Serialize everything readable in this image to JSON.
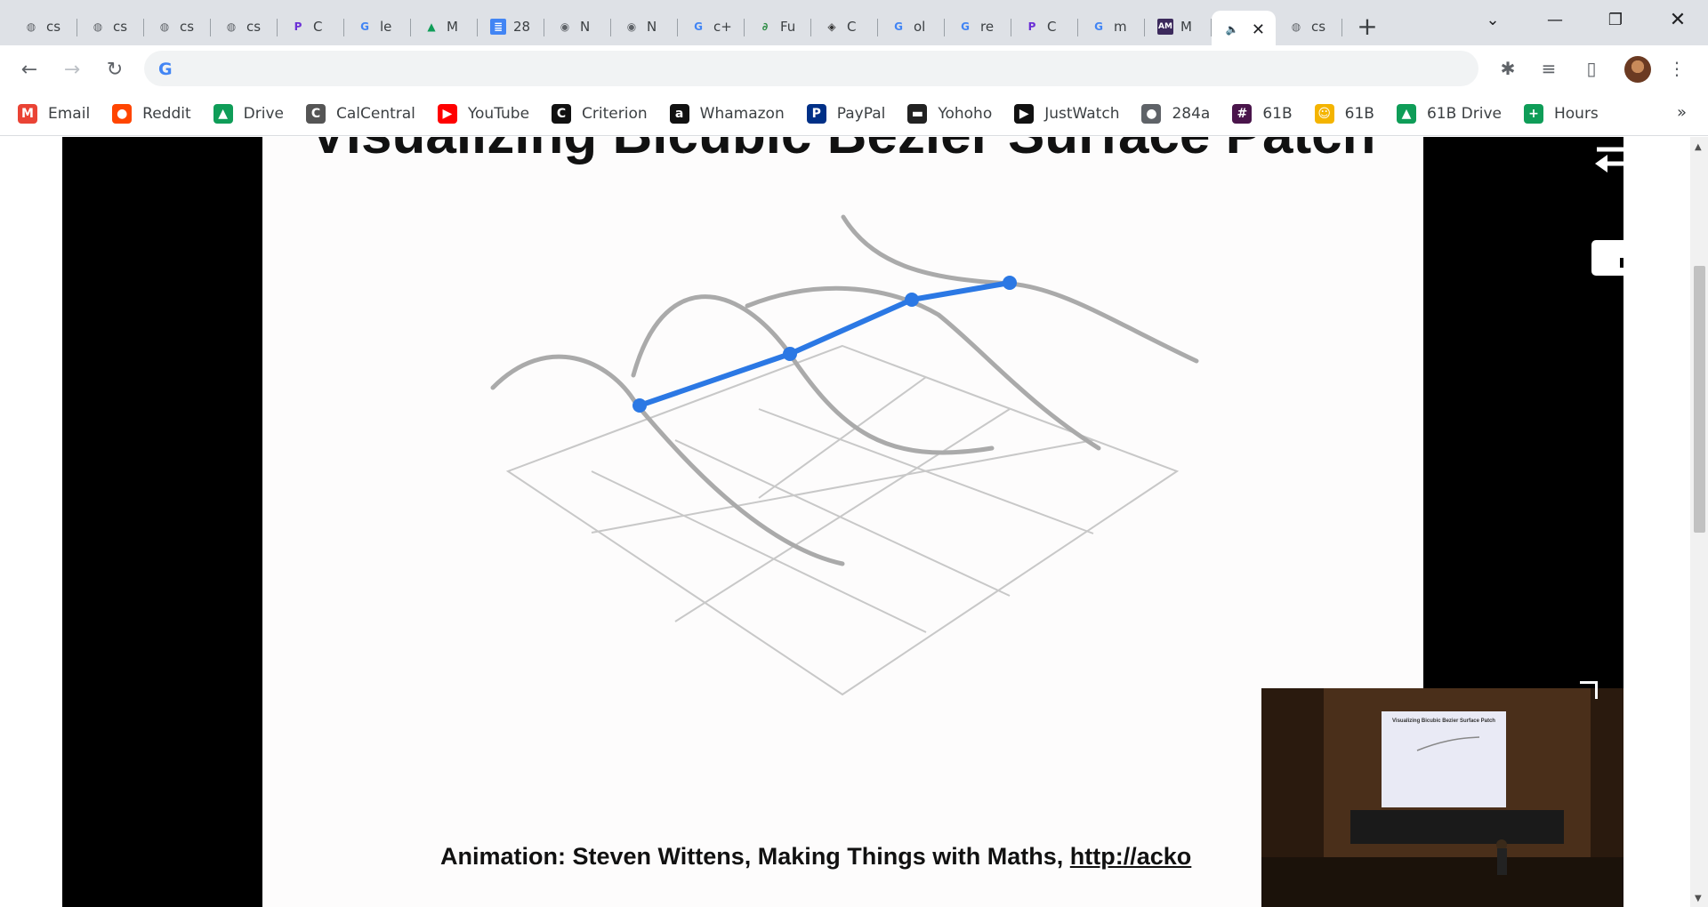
{
  "tabs": [
    {
      "label": "cs",
      "icon": "globe-icon",
      "color": "#5f6368"
    },
    {
      "label": "cs",
      "icon": "globe-icon",
      "color": "#5f6368"
    },
    {
      "label": "cs",
      "icon": "globe-icon",
      "color": "#5f6368"
    },
    {
      "label": "cs",
      "icon": "globe-icon",
      "color": "#5f6368"
    },
    {
      "label": "C",
      "icon": "piazza-icon",
      "color": "#6b2fd6"
    },
    {
      "label": "le",
      "icon": "google-icon",
      "color": "#4285f4"
    },
    {
      "label": "M",
      "icon": "drive-icon",
      "color": "#0f9d58"
    },
    {
      "label": "28",
      "icon": "docs-icon",
      "color": "#4285f4"
    },
    {
      "label": "N",
      "icon": "chrome-icon",
      "color": "#5f6368"
    },
    {
      "label": "N",
      "icon": "chrome-icon",
      "color": "#5f6368"
    },
    {
      "label": "c+",
      "icon": "google-icon",
      "color": "#4285f4"
    },
    {
      "label": "Fu",
      "icon": "gfg-icon",
      "color": "#2f8d46"
    },
    {
      "label": "C",
      "icon": "diamond-icon",
      "color": "#333333"
    },
    {
      "label": "ol",
      "icon": "google-icon",
      "color": "#4285f4"
    },
    {
      "label": "re",
      "icon": "google-icon",
      "color": "#4285f4"
    },
    {
      "label": "C",
      "icon": "piazza-icon",
      "color": "#6b2fd6"
    },
    {
      "label": "m",
      "icon": "google-icon",
      "color": "#4285f4"
    },
    {
      "label": "M",
      "icon": "am-icon",
      "color": "#3c2a5c"
    },
    {
      "label": "",
      "icon": "speaker-icon",
      "color": "#202124",
      "active": true
    },
    {
      "label": "cs",
      "icon": "globe-icon",
      "color": "#5f6368"
    }
  ],
  "bookmarks": [
    {
      "label": "Email",
      "icon": "gmail-icon",
      "glyph": "M",
      "color": "#ea4335"
    },
    {
      "label": "Reddit",
      "icon": "reddit-icon",
      "glyph": "●",
      "color": "#ff4500"
    },
    {
      "label": "Drive",
      "icon": "drive-icon",
      "glyph": "▲",
      "color": "#0f9d58"
    },
    {
      "label": "CalCentral",
      "icon": "calcentral-icon",
      "glyph": "C",
      "color": "#555555"
    },
    {
      "label": "YouTube",
      "icon": "youtube-icon",
      "glyph": "▶",
      "color": "#ff0000"
    },
    {
      "label": "Criterion",
      "icon": "criterion-icon",
      "glyph": "C",
      "color": "#111111"
    },
    {
      "label": "Whamazon",
      "icon": "amazon-icon",
      "glyph": "a",
      "color": "#111111"
    },
    {
      "label": "PayPal",
      "icon": "paypal-icon",
      "glyph": "P",
      "color": "#003087"
    },
    {
      "label": "Yohoho",
      "icon": "yohoho-icon",
      "glyph": "▬",
      "color": "#222222"
    },
    {
      "label": "JustWatch",
      "icon": "justwatch-icon",
      "glyph": "▶",
      "color": "#111111"
    },
    {
      "label": "284a",
      "icon": "globe-icon",
      "glyph": "●",
      "color": "#5f6368"
    },
    {
      "label": "61B",
      "icon": "slack-icon",
      "glyph": "#",
      "color": "#4a154b"
    },
    {
      "label": "61B",
      "icon": "emoji-icon",
      "glyph": "☺",
      "color": "#f4b400"
    },
    {
      "label": "61B Drive",
      "icon": "drive-icon",
      "glyph": "▲",
      "color": "#0f9d58"
    },
    {
      "label": "Hours",
      "icon": "sheets-icon",
      "glyph": "+",
      "color": "#0f9d58"
    }
  ],
  "slide": {
    "title": "Visualizing Bicubic Bezier Surface Patch",
    "credit_text": "Animation: Steven Wittens, Making Things with Maths, ",
    "credit_link": "http://acko",
    "accent_color": "#2b78e4"
  },
  "pip": {
    "screen_title": "Visualizing Bicubic Bezier Surface Patch"
  }
}
